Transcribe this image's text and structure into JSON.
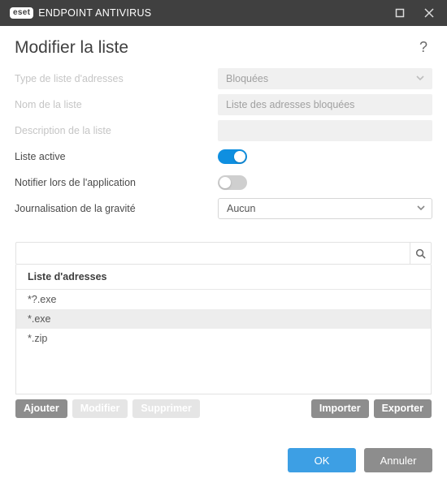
{
  "titlebar": {
    "brand_badge": "eset",
    "product": "ENDPOINT ANTIVIRUS"
  },
  "heading": "Modifier la liste",
  "form": {
    "type_label": "Type de liste d'adresses",
    "type_value": "Bloquées",
    "name_label": "Nom de la liste",
    "name_placeholder": "Liste des adresses bloquées",
    "desc_label": "Description de la liste",
    "desc_value": "",
    "active_label": "Liste active",
    "active_on": true,
    "notify_label": "Notifier lors de l'application",
    "notify_on": false,
    "severity_label": "Journalisation de la gravité",
    "severity_value": "Aucun"
  },
  "list": {
    "header": "Liste d'adresses",
    "items": [
      {
        "text": "*?.exe",
        "selected": false
      },
      {
        "text": "*.exe",
        "selected": true
      },
      {
        "text": "*.zip",
        "selected": false
      }
    ],
    "actions": {
      "add": "Ajouter",
      "edit": "Modifier",
      "delete": "Supprimer",
      "import": "Importer",
      "export": "Exporter"
    }
  },
  "footer": {
    "ok": "OK",
    "cancel": "Annuler"
  }
}
